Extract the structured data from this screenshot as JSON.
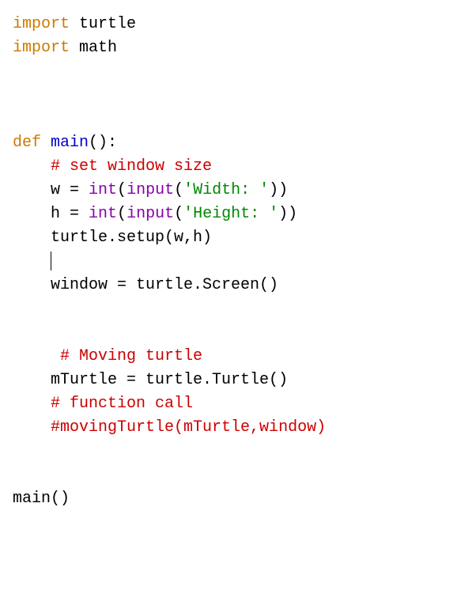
{
  "code": {
    "l01_import": "import",
    "l01_mod": " turtle",
    "l02_import": "import",
    "l02_mod": " math",
    "l05_def": "def",
    "l05_fn": "main",
    "l05_rest": "():",
    "l06_comment": "# set window size",
    "l07_a": "w = ",
    "l07_int": "int",
    "l07_b": "(",
    "l07_input": "input",
    "l07_c": "(",
    "l07_str": "'Width: '",
    "l07_d": "))",
    "l08_a": "h = ",
    "l08_int": "int",
    "l08_b": "(",
    "l08_input": "input",
    "l08_c": "(",
    "l08_str": "'Height: '",
    "l08_d": "))",
    "l09": "turtle.setup(w,h)",
    "l11": "window = turtle.Screen()",
    "l14_comment": "# Moving turtle",
    "l15": "mTurtle = turtle.Turtle()",
    "l16_comment": "# function call",
    "l17_comment": "#movingTurtle(mTurtle,window)",
    "l20": "main()"
  }
}
